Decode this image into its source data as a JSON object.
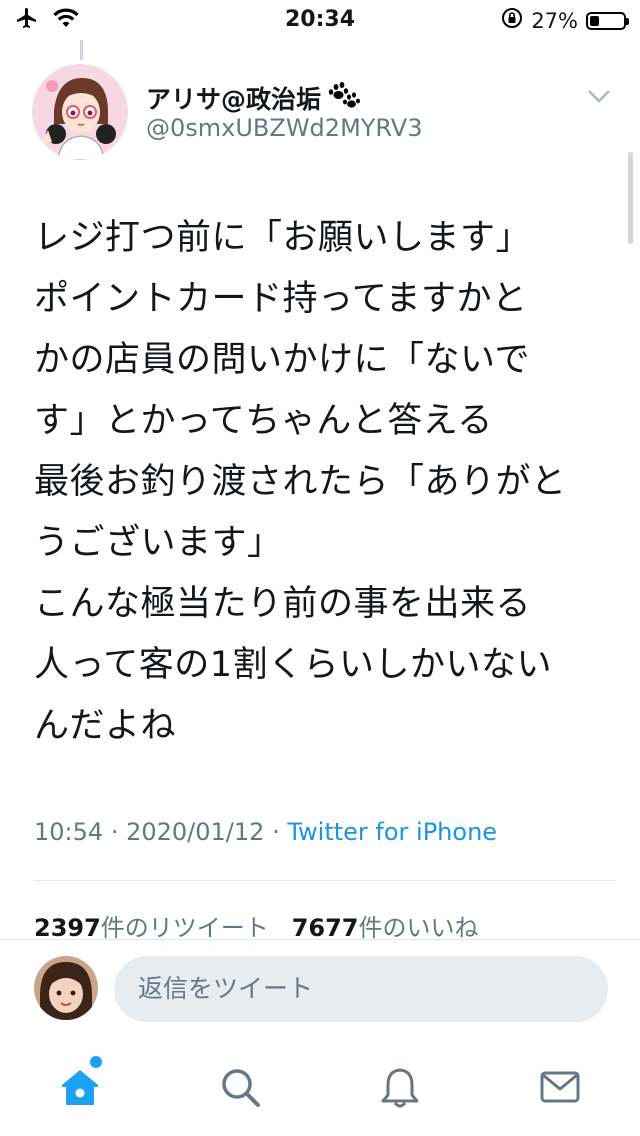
{
  "status_bar": {
    "time": "20:34",
    "battery_text": "27%",
    "battery_level": 0.27,
    "icons": [
      "airplane-icon",
      "wifi-icon",
      "orientation-lock-icon",
      "battery-icon"
    ]
  },
  "tweet": {
    "user_name": "アリサ@政治垢",
    "name_emoji": "paw-prints-icon",
    "handle": "@0smxUBZWd2MYRV3",
    "text_lines": [
      "レジ打つ前に「お願いします」",
      "ポイントカード持ってますかと",
      "かの店員の問いかけに「ないで",
      "す」とかってちゃんと答える",
      "最後お釣り渡されたら「ありがと",
      "うございます」",
      "こんな極当たり前の事を出来る",
      "人って客の1割くらいしかいない",
      "んだよね"
    ],
    "time": "10:54",
    "separator": "·",
    "date": "2020/01/12",
    "source": "Twitter for iPhone",
    "retweet_count": "2397",
    "retweet_label": "件のリツイート",
    "like_count": "7677",
    "like_label": "件のいいね"
  },
  "reply": {
    "placeholder": "返信をツイート"
  },
  "tabbar": {
    "items": [
      "home-icon",
      "search-icon",
      "notifications-icon",
      "messages-icon"
    ],
    "accent": "#1da1f2",
    "inactive": "#657786"
  },
  "colors": {
    "text": "#14171a",
    "secondary": "#657786",
    "link": "#1b95e0",
    "reply_box": "#e6ecf0"
  }
}
